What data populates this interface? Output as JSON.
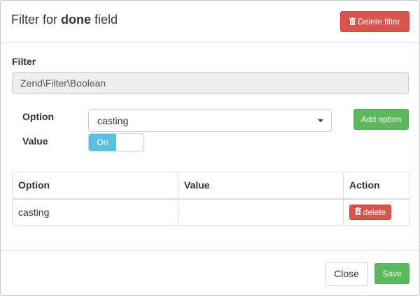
{
  "modal": {
    "title_prefix": "Filter for",
    "title_field": "done",
    "title_suffix": "field",
    "delete_filter_label": "Delete filter"
  },
  "filter": {
    "label": "Filter",
    "value": "Zend\\Filter\\Boolean"
  },
  "option": {
    "label": "Option",
    "selected": "casting",
    "add_label": "Add option"
  },
  "value": {
    "label": "Value",
    "toggle_on_label": "On"
  },
  "table": {
    "headers": [
      "Option",
      "Value",
      "Action"
    ],
    "rows": [
      {
        "option": "casting",
        "value": "",
        "action_label": "delete"
      }
    ]
  },
  "footer": {
    "close_label": "Close",
    "save_label": "Save"
  },
  "colors": {
    "danger": "#d9534f",
    "success": "#5cb85c",
    "info": "#5bc0de"
  },
  "icons": {
    "delete_filter_icon": "trash-icon",
    "row_delete_icon": "trash-icon",
    "select_caret": "chevron-down-icon"
  }
}
